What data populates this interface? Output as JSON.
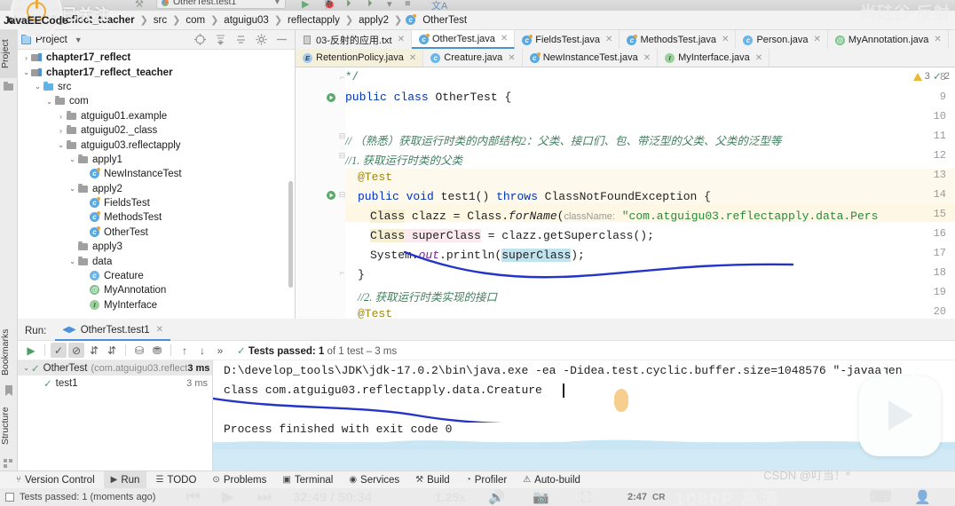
{
  "window": {
    "run_config": "OtherTest.test1",
    "overlay_follow_label": "已关注",
    "overlay_brand": "JavaEECode",
    "watermark_right_top": "尚硅谷·反射",
    "watermark_csdn": "CSDN @叮当！*",
    "watermark_quality": "1080P 高清",
    "watermark_time": "32:49 / 50:34",
    "watermark_speed": "1.25x",
    "watermark_clock": "2:47"
  },
  "breadcrumb": {
    "items": [
      {
        "label": "chapter17_reflect_teacher",
        "bold": true
      },
      {
        "label": "src",
        "bold": false
      },
      {
        "label": "com",
        "bold": false
      },
      {
        "label": "atguigu03",
        "bold": false
      },
      {
        "label": "reflectapply",
        "bold": false
      },
      {
        "label": "apply2",
        "bold": false
      },
      {
        "label": "OtherTest",
        "bold": false,
        "icon": "class-icon"
      }
    ]
  },
  "left_strip": {
    "tabs": [
      {
        "label": "Project",
        "selected": true,
        "icon": "project-icon"
      },
      {
        "label": "Bookmarks",
        "selected": false,
        "icon": "bookmark-icon"
      },
      {
        "label": "Structure",
        "selected": false,
        "icon": "structure-icon"
      }
    ]
  },
  "project_panel": {
    "title": "Project",
    "actions": [
      "locate-icon",
      "expand-all-icon",
      "collapse-all-icon",
      "settings-icon",
      "hide-icon"
    ],
    "tree": [
      {
        "label": "chapter17_reflect",
        "indent": 0,
        "arrow": "right",
        "icon": "module-icon",
        "bold": true
      },
      {
        "label": "chapter17_reflect_teacher",
        "indent": 0,
        "arrow": "down",
        "icon": "module-icon",
        "bold": true
      },
      {
        "label": "src",
        "indent": 1,
        "arrow": "down",
        "icon": "source-folder-icon",
        "bold": false
      },
      {
        "label": "com",
        "indent": 2,
        "arrow": "down",
        "icon": "folder-icon",
        "bold": false
      },
      {
        "label": "atguigu01.example",
        "indent": 3,
        "arrow": "right",
        "icon": "package-icon",
        "bold": false
      },
      {
        "label": "atguigu02._class",
        "indent": 3,
        "arrow": "right",
        "icon": "package-icon",
        "bold": false
      },
      {
        "label": "atguigu03.reflectapply",
        "indent": 3,
        "arrow": "down",
        "icon": "package-icon",
        "bold": false
      },
      {
        "label": "apply1",
        "indent": 4,
        "arrow": "down",
        "icon": "package-icon",
        "bold": false
      },
      {
        "label": "NewInstanceTest",
        "indent": 5,
        "arrow": "none",
        "icon": "test-class-icon",
        "bold": false
      },
      {
        "label": "apply2",
        "indent": 4,
        "arrow": "down",
        "icon": "package-icon",
        "bold": false
      },
      {
        "label": "FieldsTest",
        "indent": 5,
        "arrow": "none",
        "icon": "test-class-icon",
        "bold": false
      },
      {
        "label": "MethodsTest",
        "indent": 5,
        "arrow": "none",
        "icon": "test-class-icon",
        "bold": false
      },
      {
        "label": "OtherTest",
        "indent": 5,
        "arrow": "none",
        "icon": "test-class-icon",
        "bold": false
      },
      {
        "label": "apply3",
        "indent": 4,
        "arrow": "none",
        "icon": "package-icon",
        "bold": false
      },
      {
        "label": "data",
        "indent": 4,
        "arrow": "down",
        "icon": "package-icon",
        "bold": false
      },
      {
        "label": "Creature",
        "indent": 5,
        "arrow": "none",
        "icon": "class-icon",
        "bold": false
      },
      {
        "label": "MyAnnotation",
        "indent": 5,
        "arrow": "none",
        "icon": "annotation-icon",
        "bold": false
      },
      {
        "label": "MyInterface",
        "indent": 5,
        "arrow": "none",
        "icon": "interface-icon",
        "bold": false
      }
    ]
  },
  "editor": {
    "tabs_row1": [
      {
        "label": "03-反射的应用.txt",
        "icon": "text-file-icon",
        "active": false,
        "style": "normal"
      },
      {
        "label": "OtherTest.java",
        "icon": "test-class-icon",
        "active": true,
        "style": "normal"
      },
      {
        "label": "FieldsTest.java",
        "icon": "test-class-icon",
        "active": false,
        "style": "normal"
      },
      {
        "label": "MethodsTest.java",
        "icon": "test-class-icon",
        "active": false,
        "style": "normal"
      },
      {
        "label": "Person.java",
        "icon": "class-icon",
        "active": false,
        "style": "normal"
      },
      {
        "label": "MyAnnotation.java",
        "icon": "annotation-icon",
        "active": false,
        "style": "normal"
      }
    ],
    "tabs_row2": [
      {
        "label": "RetentionPolicy.java",
        "icon": "enum-icon",
        "active": false,
        "style": "yellowed"
      },
      {
        "label": "Creature.java",
        "icon": "class-icon",
        "active": false,
        "style": "normal"
      },
      {
        "label": "NewInstanceTest.java",
        "icon": "test-class-icon",
        "active": false,
        "style": "normal"
      },
      {
        "label": "MyInterface.java",
        "icon": "interface-icon",
        "active": false,
        "style": "normal"
      }
    ],
    "inspection": {
      "warning_count": "3",
      "check_count": "2"
    },
    "lines": [
      {
        "num": "8",
        "gutter": "",
        "fold": "fold-end"
      },
      {
        "num": "9",
        "gutter": "run-test-icon",
        "fold": ""
      },
      {
        "num": "10",
        "gutter": "",
        "fold": ""
      },
      {
        "num": "11",
        "gutter": "",
        "fold": "fold-open"
      },
      {
        "num": "12",
        "gutter": "",
        "fold": "fold-open"
      },
      {
        "num": "13",
        "gutter": "",
        "fold": ""
      },
      {
        "num": "14",
        "gutter": "run-test-icon",
        "fold": "fold-open"
      },
      {
        "num": "15",
        "gutter": "",
        "fold": ""
      },
      {
        "num": "16",
        "gutter": "",
        "fold": ""
      },
      {
        "num": "17",
        "gutter": "",
        "fold": ""
      },
      {
        "num": "18",
        "gutter": "",
        "fold": "fold-end"
      },
      {
        "num": "19",
        "gutter": "",
        "fold": ""
      },
      {
        "num": "20",
        "gutter": "",
        "fold": ""
      }
    ],
    "code": {
      "l8": "*/",
      "l9_kw1": "public",
      "l9_kw2": "class",
      "l9_name": "OtherTest {",
      "l11": "// （熟悉）获取运行时类的内部结构2：父类、接口们、包、带泛型的父类、父类的泛型等",
      "l12": "//1. 获取运行时类的父类",
      "l13": "@Test",
      "l14_kw1": "public",
      "l14_kw2": "void",
      "l14_rest": " test1() ",
      "l14_kw3": "throws",
      "l14_exc": " ClassNotFoundException {",
      "l15_a": "Class",
      "l15_b": " clazz = Class.",
      "l15_c": "forName",
      "l15_d": "(",
      "l15_hint": "className:",
      "l15_str": " \"com.atguigu03.reflectapply.data.Pers",
      "l16_a": "Class",
      "l16_b": " superClass",
      "l16_c": " = clazz.getSuperclass();",
      "l17_a": "System.",
      "l17_b": "out",
      "l17_c": ".println(",
      "l17_d": "superClass",
      "l17_e": ");",
      "l18": "}",
      "l19": "//2. 获取运行时类实现的接口",
      "l20": "@Test"
    }
  },
  "run_panel": {
    "label": "Run:",
    "tab_label": "OtherTest.test1",
    "toolbar_icons": [
      "rerun-icon",
      "show-passed-icon",
      "hide-ignored-icon",
      "sort-alpha-icon",
      "sort-duration-icon",
      "expand-all-icon",
      "collapse-all-icon",
      "prev-failed-icon",
      "next-failed-icon",
      "more-icon"
    ],
    "status_prefix": "Tests passed:",
    "status_count": "1",
    "status_suffix": "of 1 test – 3 ms",
    "tests": [
      {
        "name": "OtherTest",
        "package": "(com.atguigu03.reflect",
        "duration": "3 ms",
        "indent": 0,
        "arrow": "down",
        "selected": true
      },
      {
        "name": "test1",
        "package": "",
        "duration": "3 ms",
        "indent": 1,
        "arrow": "none",
        "selected": false
      }
    ],
    "console": [
      "D:\\develop_tools\\JDK\\jdk-17.0.2\\bin\\java.exe -ea -Didea.test.cyclic.buffer.size=1048576 \"-javaagen",
      "class com.atguigu03.reflectapply.data.Creature",
      "",
      "Process finished with exit code 0"
    ]
  },
  "status_bar": {
    "items": [
      {
        "label": "Version Control",
        "icon": "branch-icon",
        "active": false
      },
      {
        "label": "Run",
        "icon": "play-icon",
        "active": true
      },
      {
        "label": "TODO",
        "icon": "list-icon",
        "active": false
      },
      {
        "label": "Problems",
        "icon": "error-icon",
        "active": false
      },
      {
        "label": "Terminal",
        "icon": "terminal-icon",
        "active": false
      },
      {
        "label": "Services",
        "icon": "services-icon",
        "active": false
      },
      {
        "label": "Build",
        "icon": "hammer-icon",
        "active": false
      },
      {
        "label": "Profiler",
        "icon": "profiler-icon",
        "active": false
      },
      {
        "label": "Auto-build",
        "icon": "warning-icon",
        "active": false
      }
    ]
  },
  "footer": {
    "text": "Tests passed: 1 (moments ago)"
  },
  "colors": {
    "accent": "#4a90d9",
    "keyword": "#0033b3",
    "comment": "#3f7f5f",
    "string": "#2a8a3e",
    "annotation": "#9e880d",
    "ink": "#2433c8",
    "pass": "#4e9f63",
    "warn": "#e8b931"
  }
}
